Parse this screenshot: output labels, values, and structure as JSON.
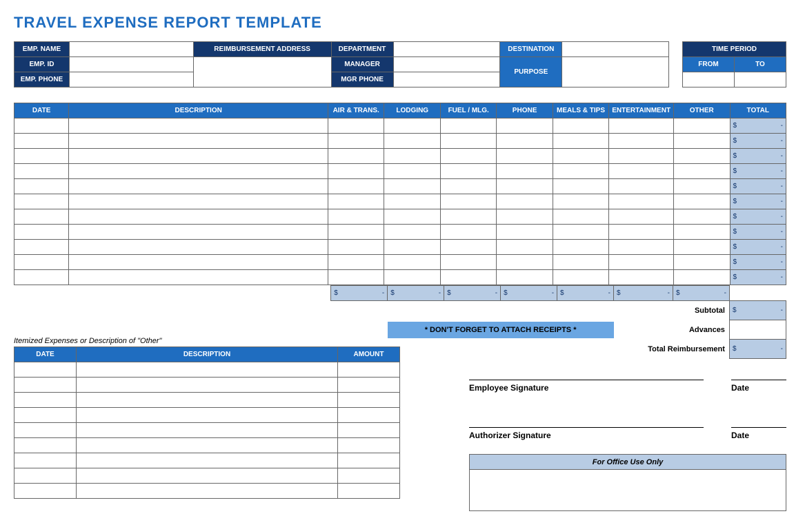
{
  "title": "TRAVEL EXPENSE REPORT TEMPLATE",
  "info": {
    "emp_name_lbl": "EMP. NAME",
    "emp_id_lbl": "EMP. ID",
    "emp_phone_lbl": "EMP. PHONE",
    "reimb_addr_lbl": "REIMBURSEMENT ADDRESS",
    "dept_lbl": "DEPARTMENT",
    "manager_lbl": "MANAGER",
    "mgr_phone_lbl": "MGR PHONE",
    "dest_lbl": "DESTINATION",
    "purpose_lbl": "PURPOSE",
    "time_period_lbl": "TIME PERIOD",
    "from_lbl": "FROM",
    "to_lbl": "TO"
  },
  "cols": {
    "date": "DATE",
    "desc": "DESCRIPTION",
    "air": "AIR & TRANS.",
    "lodging": "LODGING",
    "fuel": "FUEL / MLG.",
    "phone": "PHONE",
    "meals": "MEALS & TIPS",
    "ent": "ENTERTAINMENT",
    "other": "OTHER",
    "total": "TOTAL",
    "amount": "AMOUNT"
  },
  "dollar_dash": {
    "sym": "$",
    "dash": "-"
  },
  "summary": {
    "subtotal_lbl": "Subtotal",
    "advances_lbl": "Advances",
    "total_reimb_lbl": "Total Reimbursement"
  },
  "receipt_note": "* DON'T FORGET TO ATTACH RECEIPTS *",
  "itemized_note": "Itemized Expenses or Description of \"Other\"",
  "sig": {
    "emp": "Employee Signature",
    "auth": "Authorizer Signature",
    "date": "Date"
  },
  "office": "For Office Use Only"
}
